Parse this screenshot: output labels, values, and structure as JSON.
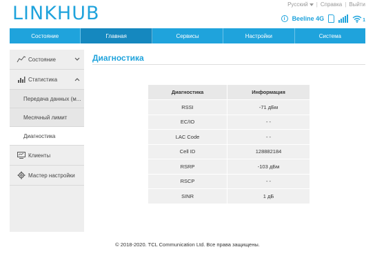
{
  "brand": {
    "link": "LINK",
    "hub": "HUB"
  },
  "top_links": {
    "language": "Русский",
    "help": "Справка",
    "logout": "Выйти"
  },
  "status": {
    "operator": "Beeline 4G",
    "wifi_clients": "1"
  },
  "nav": {
    "items": [
      "Состояние",
      "Главная",
      "Сервисы",
      "Настройки",
      "Система"
    ]
  },
  "sidebar": {
    "status": "Состояние",
    "statistics": "Статистика",
    "sub": [
      "Передача данных (м...",
      "Месячный лимит",
      "Диагностика"
    ],
    "clients": "Клиенты",
    "wizard": "Мастер настройки"
  },
  "page": {
    "title": "Диагностика"
  },
  "table": {
    "headers": [
      "Диагностика",
      "Информация"
    ],
    "rows": [
      [
        "RSSI",
        "-71 дБм"
      ],
      [
        "EC/IO",
        "- -"
      ],
      [
        "LAC Code",
        "- -"
      ],
      [
        "Cell ID",
        "128882184"
      ],
      [
        "RSRP",
        "-103 дБм"
      ],
      [
        "RSCP",
        "- -"
      ],
      [
        "SINR",
        "1 дБ"
      ]
    ]
  },
  "footer": "© 2018-2020. TCL Communication Ltd. Все права защищены.",
  "colors": {
    "accent": "#1fa3dc",
    "nav_active": "#1588bf"
  }
}
